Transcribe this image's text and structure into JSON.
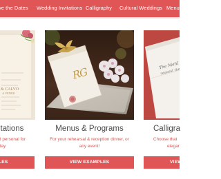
{
  "nav": {
    "items": [
      "ve the Dates",
      "Wedding Invitations",
      "Calligraphy",
      "Cultural Weddings",
      "Menus"
    ]
  },
  "cards": [
    {
      "title": "itations",
      "desc_line1": "d personal for",
      "desc_line2": "day",
      "button": "LES",
      "card_text_1": "& CALVO",
      "card_text_2": "A VENUE"
    },
    {
      "title": "Menus & Programs",
      "desc_line1": "For your rehearsal & reception dinner, or",
      "desc_line2": "any event!",
      "button": "VIEW EXAMPLES",
      "monogram": "RG"
    },
    {
      "title": "Calligra",
      "desc_line1": "Choose that",
      "desc_line2": "elegar",
      "button": "VIEW",
      "script_line_1": "The Mehl",
      "script_line_2": "request the"
    }
  ],
  "colors": {
    "accent": "#e05657",
    "accent_text": "#d9534f",
    "title_text": "#4a4a4a"
  }
}
